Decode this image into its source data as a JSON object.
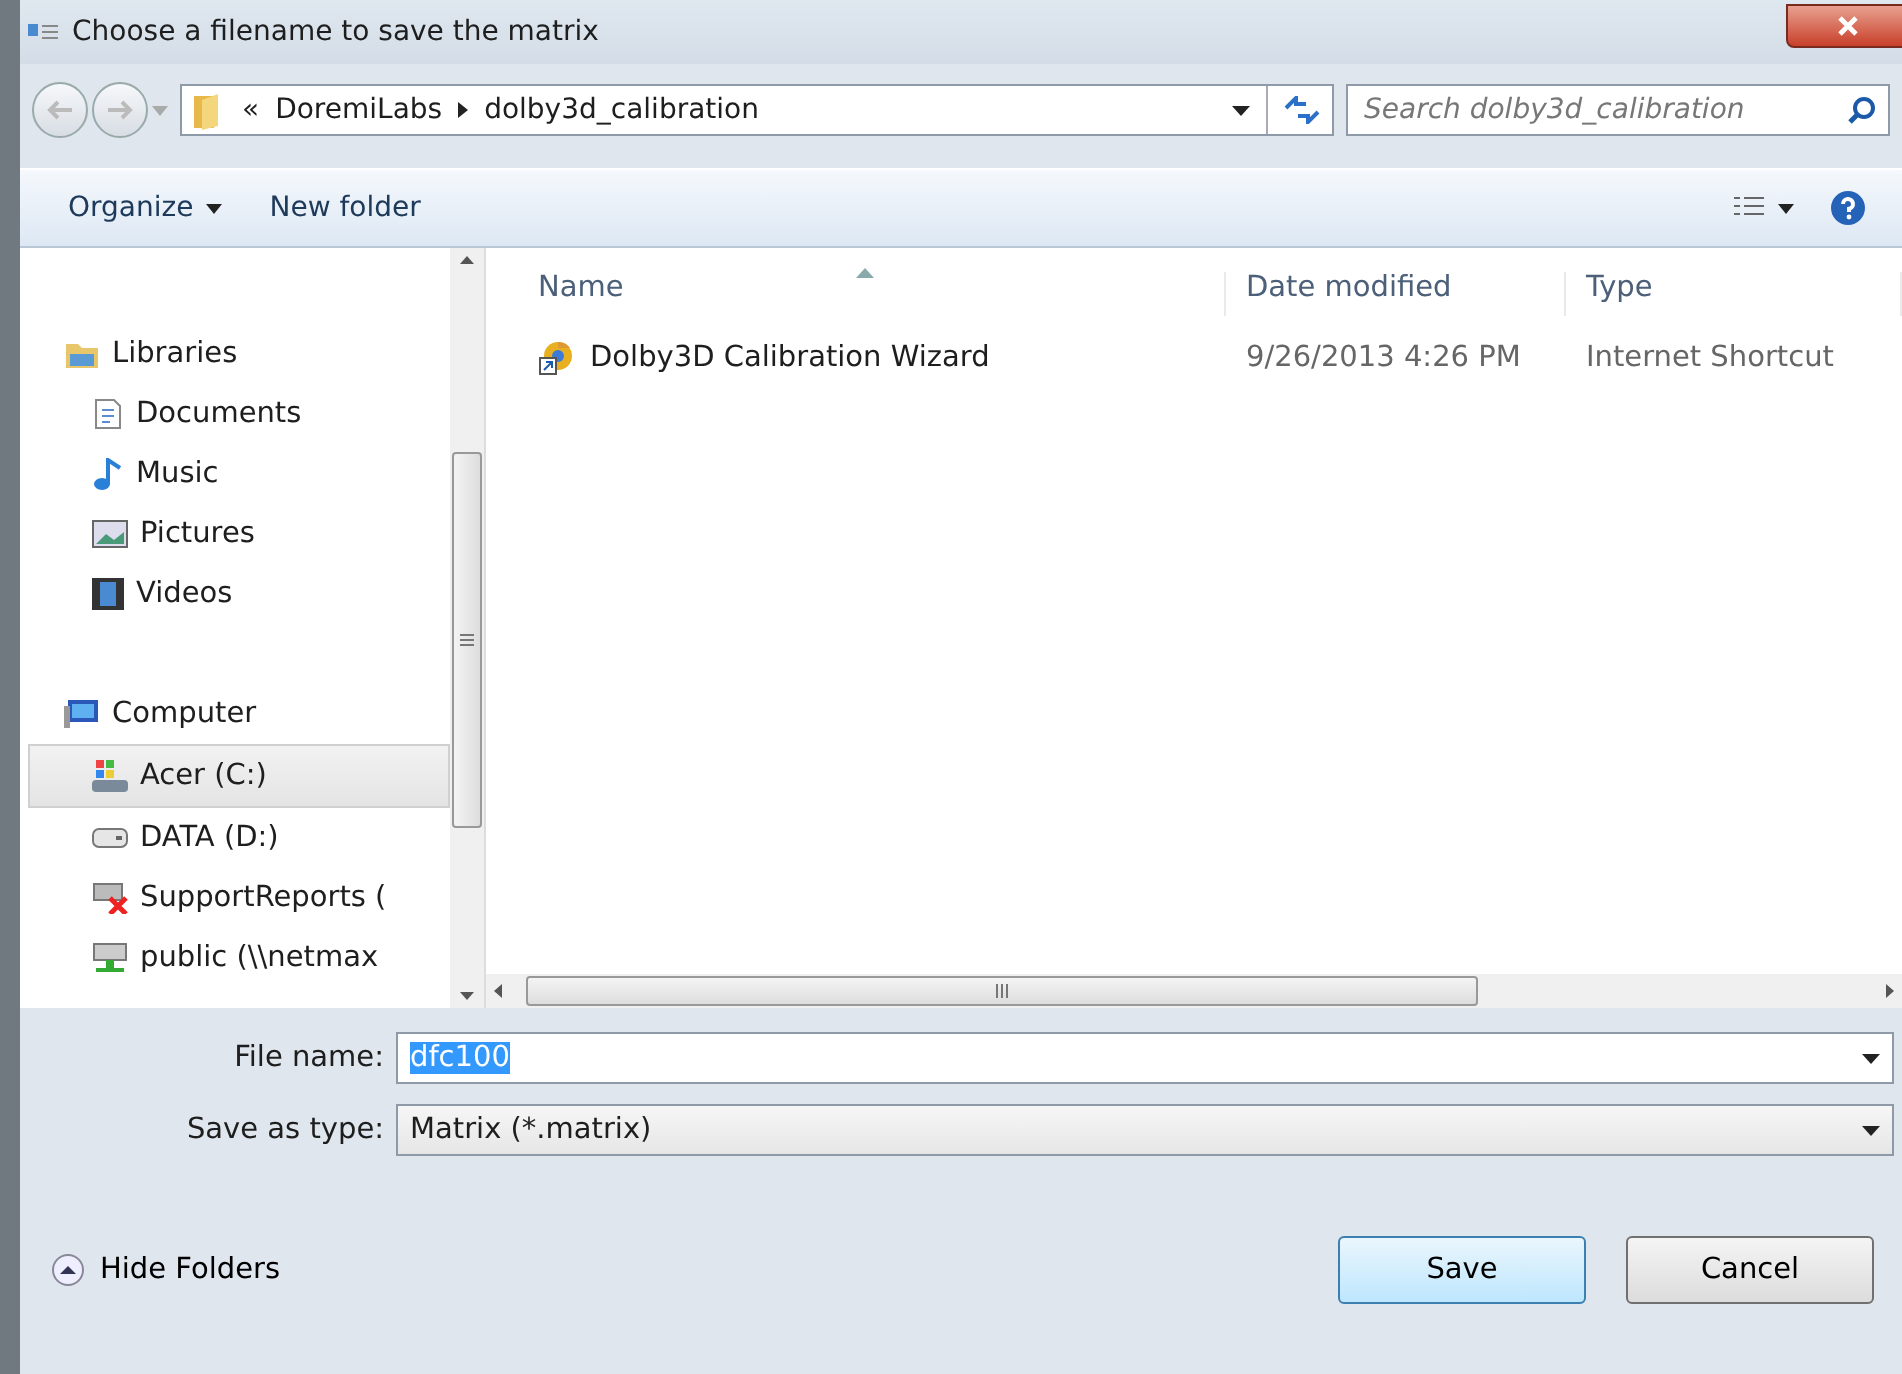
{
  "window": {
    "title": "Choose a filename to save the matrix"
  },
  "address": {
    "overflow": "«",
    "crumbs": [
      "DoremiLabs",
      "dolby3d_calibration"
    ]
  },
  "search": {
    "placeholder": "Search dolby3d_calibration"
  },
  "toolbar": {
    "organize": "Organize",
    "new_folder": "New folder"
  },
  "navigation": [
    {
      "label": "Libraries",
      "selected": false,
      "children": [
        {
          "label": "Documents",
          "selected": false
        },
        {
          "label": "Music",
          "selected": false
        },
        {
          "label": "Pictures",
          "selected": false
        },
        {
          "label": "Videos",
          "selected": false
        }
      ]
    },
    {
      "label": "Computer",
      "selected": false,
      "children": [
        {
          "label": "Acer (C:)",
          "selected": true
        },
        {
          "label": "DATA (D:)",
          "selected": false
        },
        {
          "label": "SupportReports (",
          "selected": false
        },
        {
          "label": "public (\\\\netmax",
          "selected": false
        }
      ]
    }
  ],
  "columns": [
    {
      "label": "Name",
      "sorted": true
    },
    {
      "label": "Date modified",
      "sorted": false
    },
    {
      "label": "Type",
      "sorted": false
    }
  ],
  "files": [
    {
      "name": "Dolby3D Calibration Wizard",
      "date": "9/26/2013 4:26 PM",
      "type": "Internet Shortcut"
    }
  ],
  "file_name": {
    "label": "File name:",
    "value": "dfc100",
    "selected": true
  },
  "save_type": {
    "label": "Save as type:",
    "value": "Matrix (*.matrix)"
  },
  "hide_folders": "Hide Folders",
  "buttons": [
    {
      "label": "Save",
      "default": true
    },
    {
      "label": "Cancel",
      "default": false
    }
  ]
}
